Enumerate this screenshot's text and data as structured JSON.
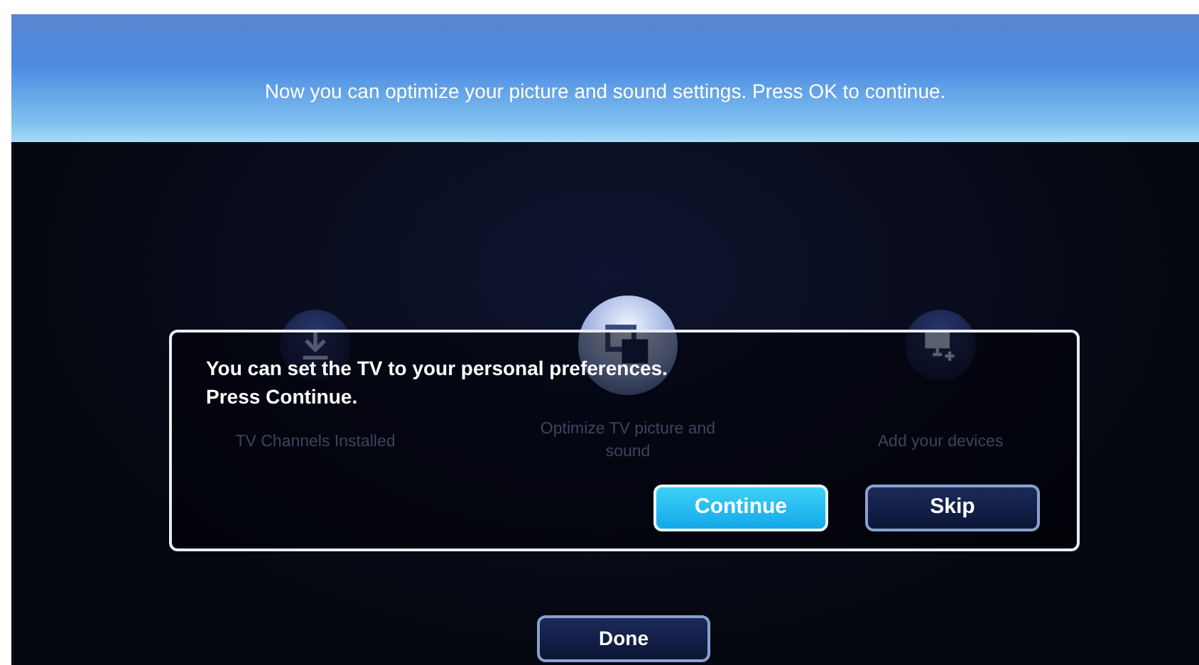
{
  "banner": {
    "text": "Now you can optimize your picture and sound settings. Press OK to continue."
  },
  "steps": [
    {
      "kind": "download",
      "label": "TV Channels Installed",
      "selected": false
    },
    {
      "kind": "screens",
      "label": "Optimize TV picture and sound",
      "selected": true
    },
    {
      "kind": "monitor-add",
      "label": "Add your devices",
      "selected": false
    }
  ],
  "dialog": {
    "message": "You can set the TV to your personal preferences.\nPress Continue.",
    "buttons": [
      {
        "label": "Continue",
        "selected": true
      },
      {
        "label": "Skip",
        "selected": false
      }
    ]
  },
  "done_button": {
    "label": "Done"
  }
}
